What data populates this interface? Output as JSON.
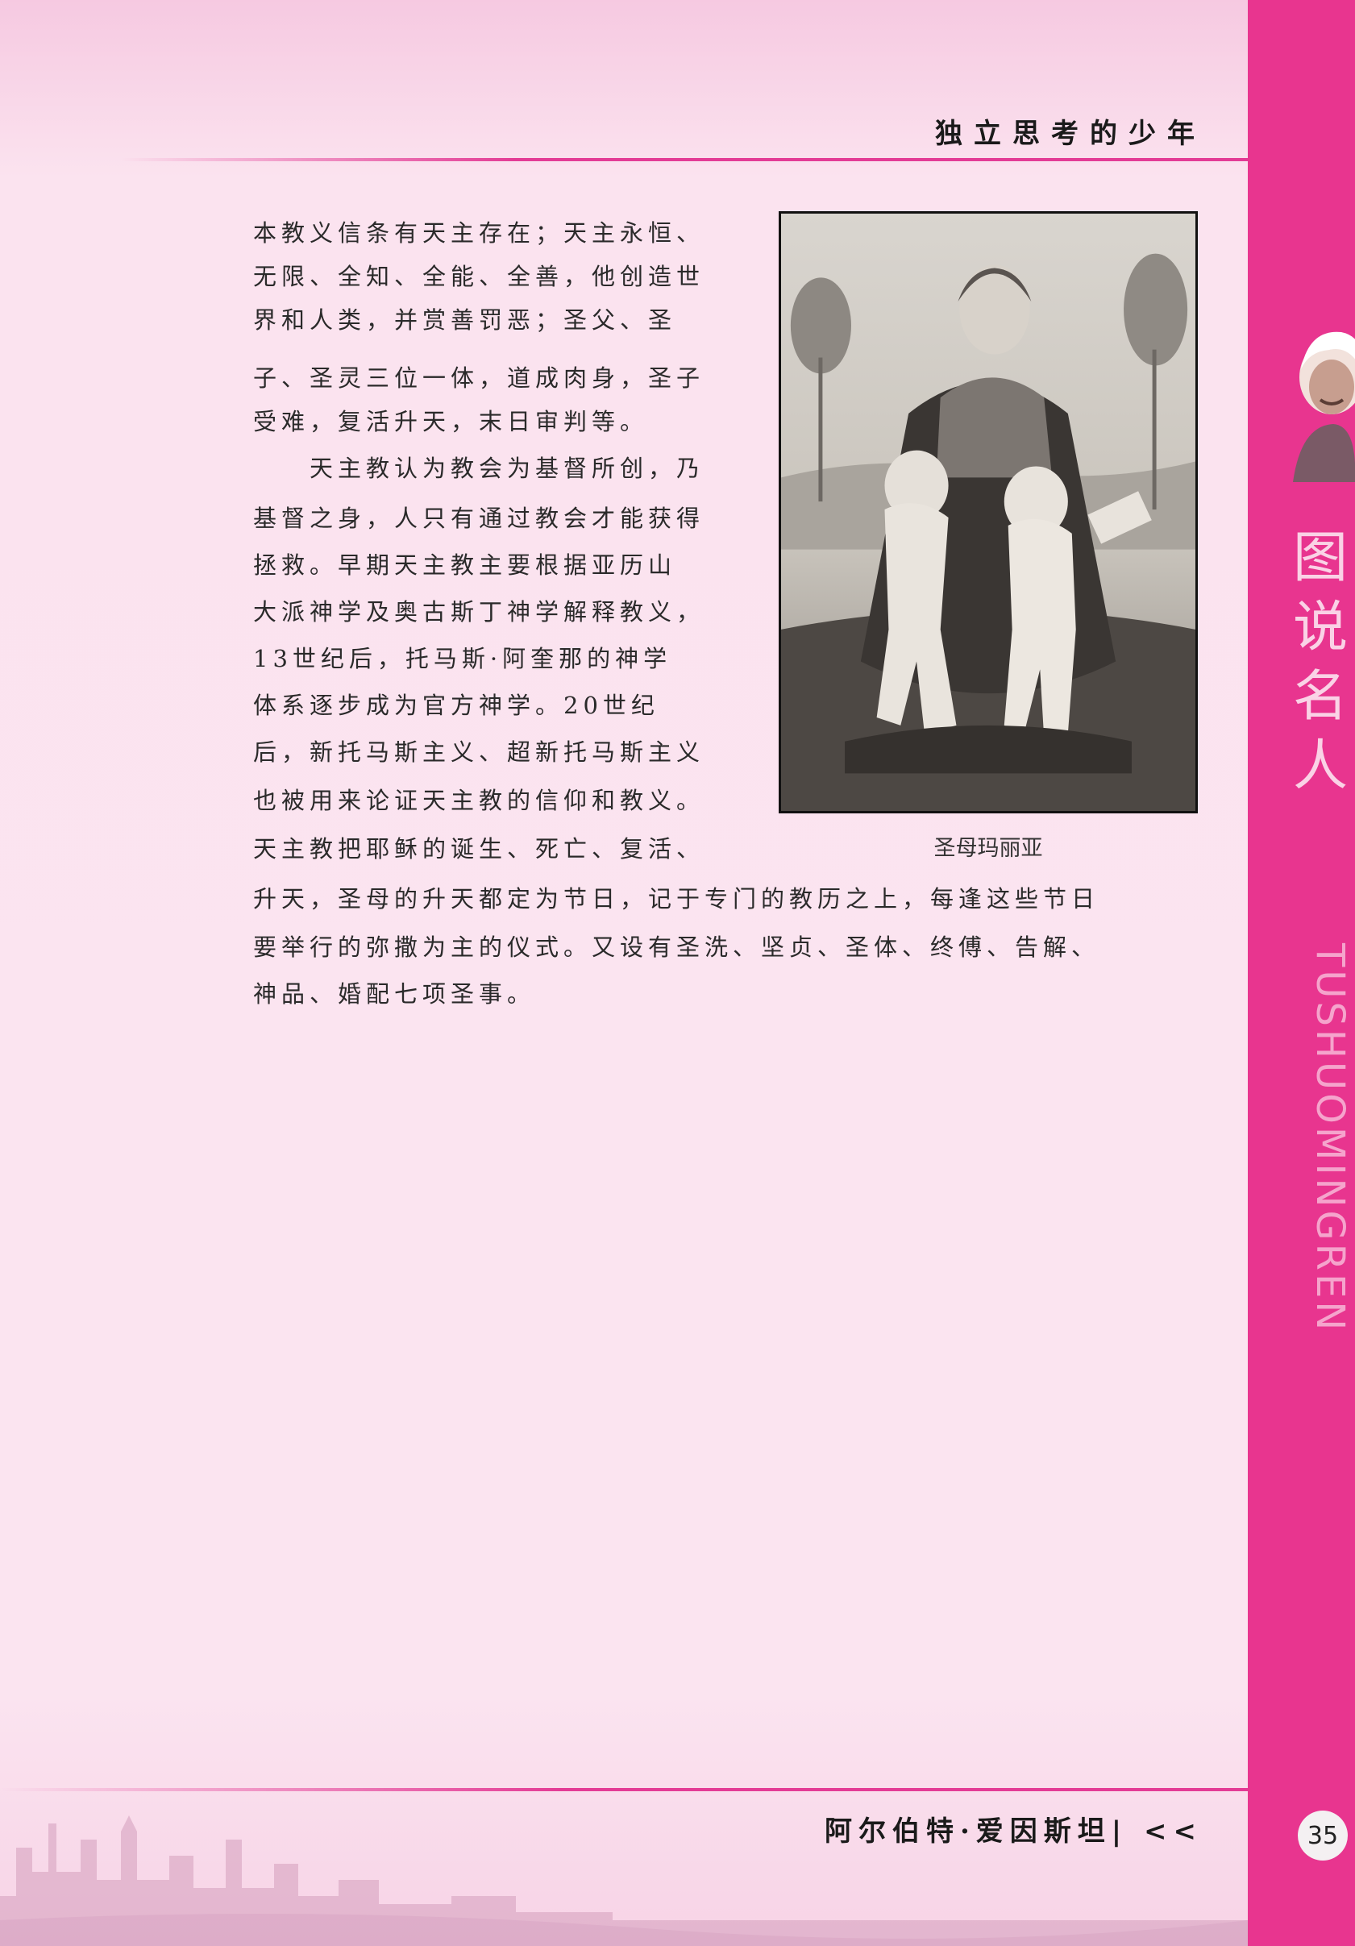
{
  "header": {
    "title": "独立思考的少年"
  },
  "body": {
    "column_lines": [
      "本教义信条有天主存在；天主永恒、",
      "无限、全知、全能、全善，他创造世",
      "界和人类，并赏善罚恶；圣父、圣",
      "子、圣灵三位一体，道成肉身，圣子",
      "受难，复活升天，末日审判等。",
      "　　天主教认为教会为基督所创，乃",
      "基督之身，人只有通过教会才能获得",
      "拯救。早期天主教主要根据亚历山",
      "大派神学及奥古斯丁神学解释教义，",
      "13世纪后，托马斯·阿奎那的神学",
      "体系逐步成为官方神学。20世纪",
      "后，新托马斯主义、超新托马斯主义",
      "也被用来论证天主教的信仰和教义。",
      "天主教把耶稣的诞生、死亡、复活、"
    ],
    "full_lines": [
      "升天，圣母的升天都定为节日，记于专门的教历之上，每逢这些节日",
      "要举行的弥撒为主的仪式。又设有圣洗、坚贞、圣体、终傅、告解、",
      "神品、婚配七项圣事。"
    ]
  },
  "figure": {
    "caption": "圣母玛丽亚"
  },
  "footer": {
    "title": "阿尔伯特·爱因斯坦| <<",
    "page_number": "35"
  },
  "sidebar": {
    "chars": [
      "图",
      "说",
      "名",
      "人"
    ],
    "pinyin": "TUSHUOMINGREN"
  },
  "colors": {
    "accent": "#e8358f",
    "page_bg": "#fbe4f0",
    "rule": "#e33c95"
  }
}
